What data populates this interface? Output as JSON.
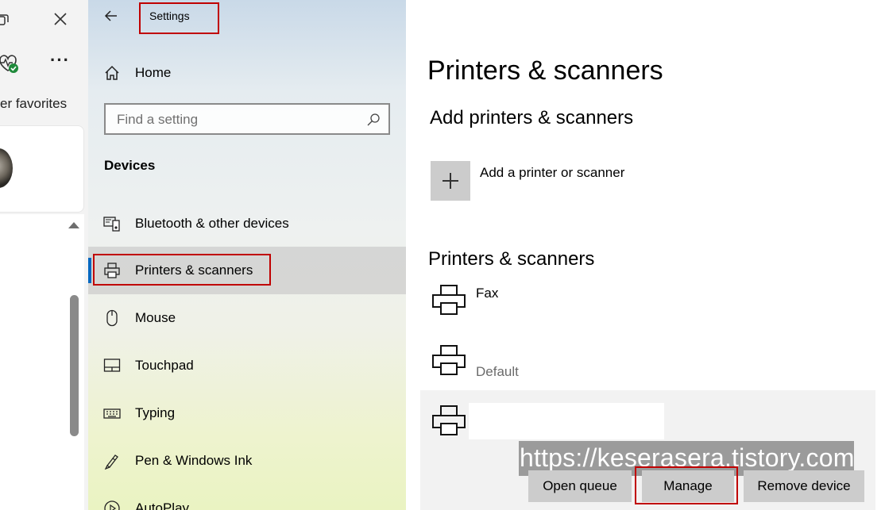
{
  "browser": {
    "favorites_text": "er favorites"
  },
  "settings": {
    "window_title": "Settings",
    "home_label": "Home",
    "search_placeholder": "Find a setting",
    "section_heading": "Devices",
    "nav_items": [
      {
        "label": "Bluetooth & other devices",
        "icon": "bluetooth-devices-icon"
      },
      {
        "label": "Printers & scanners",
        "icon": "printer-icon",
        "selected": true
      },
      {
        "label": "Mouse",
        "icon": "mouse-icon"
      },
      {
        "label": "Touchpad",
        "icon": "touchpad-icon"
      },
      {
        "label": "Typing",
        "icon": "keyboard-icon"
      },
      {
        "label": "Pen & Windows Ink",
        "icon": "pen-icon"
      },
      {
        "label": "AutoPlay",
        "icon": "autoplay-icon"
      }
    ]
  },
  "content": {
    "page_title": "Printers & scanners",
    "add_section_title": "Add printers & scanners",
    "add_label": "Add a printer or scanner",
    "list_title": "Printers & scanners",
    "devices": [
      {
        "name": "Fax",
        "status": ""
      },
      {
        "name": "",
        "status": "Default"
      },
      {
        "name": "",
        "status": "",
        "selected": true
      }
    ],
    "buttons": {
      "open_queue": "Open queue",
      "manage": "Manage",
      "remove_device": "Remove device"
    },
    "watermark": "https://keserasera.tistory.com"
  },
  "colors": {
    "highlight_border": "#c00000",
    "selection_accent": "#0067c0",
    "button_bg": "#cccccc"
  }
}
